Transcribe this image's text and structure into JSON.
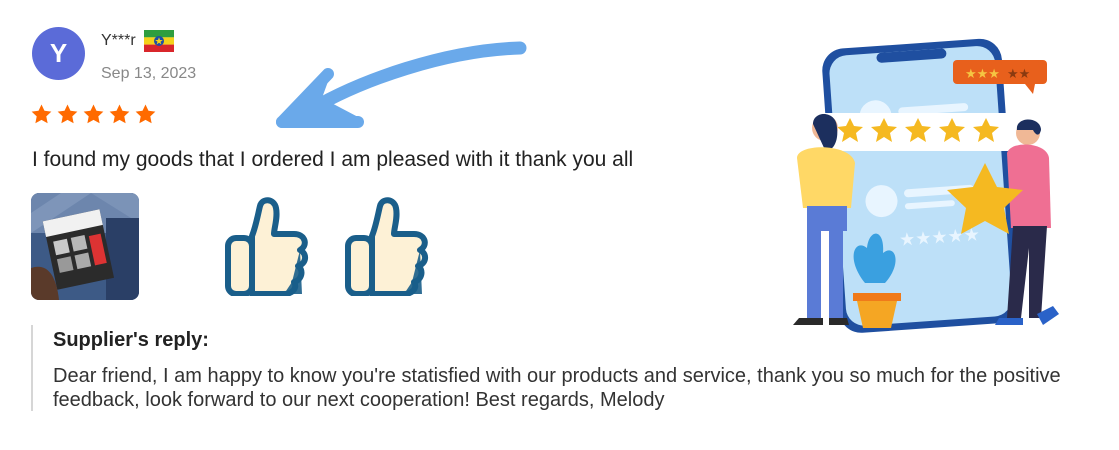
{
  "reviewer": {
    "avatar_letter": "Y",
    "name": "Y***r",
    "date": "Sep 13, 2023",
    "avatar_color": "#5b6bd8"
  },
  "review": {
    "rating": 5,
    "text": "I found my goods that I ordered I am pleased with it thank you all"
  },
  "reply": {
    "title": "Supplier's reply:",
    "text": "Dear friend, I am happy to know you're statisfied with our products and service, thank you so much for the positive feedback, look forward to our next cooperation! Best regards, Melody"
  },
  "colors": {
    "star": "#ff6a00",
    "arrow": "#6aa9ea",
    "thumb_outline": "#1a5e8a"
  },
  "icons": [
    "ethiopia-flag-icon",
    "star-icon",
    "thumbs-up-icon",
    "arrow-icon"
  ]
}
